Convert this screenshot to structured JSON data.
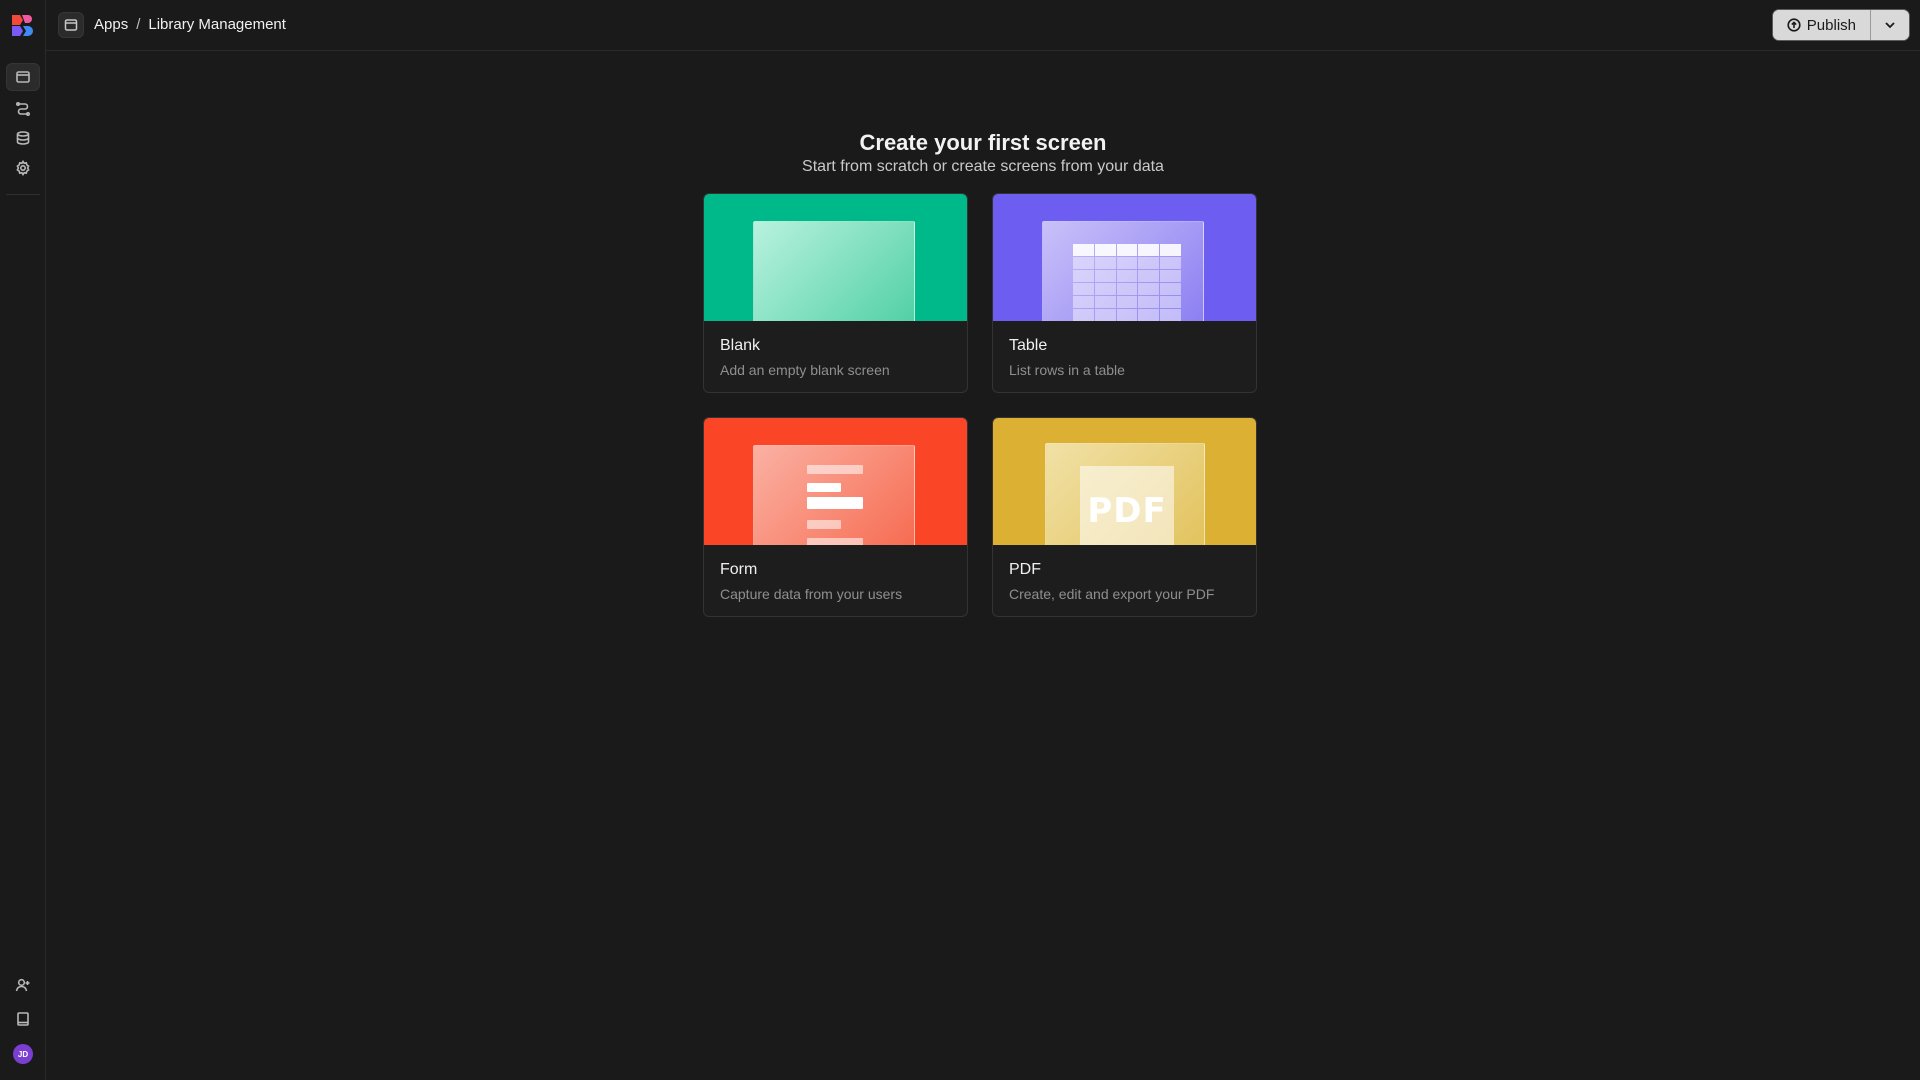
{
  "header": {
    "breadcrumb": [
      "Apps",
      "Library Management"
    ],
    "separator": "/",
    "publish_label": "Publish"
  },
  "sidebar": {
    "items": [
      {
        "icon": "screens-icon",
        "active": true
      },
      {
        "icon": "automation-icon",
        "active": false
      },
      {
        "icon": "database-icon",
        "active": false
      },
      {
        "icon": "settings-icon",
        "active": false
      }
    ],
    "bottom": [
      {
        "icon": "invite-user-icon"
      },
      {
        "icon": "book-icon"
      }
    ],
    "avatar_initials": "JD"
  },
  "main": {
    "title": "Create your first screen",
    "subtitle": "Start from scratch or create screens from your data",
    "cards": [
      {
        "key": "blank",
        "title": "Blank",
        "desc": "Add an empty blank screen",
        "color": "#00b98a"
      },
      {
        "key": "table",
        "title": "Table",
        "desc": "List rows in a table",
        "color": "#6d5df0"
      },
      {
        "key": "form",
        "title": "Form",
        "desc": "Capture data from your users",
        "color": "#fa4527"
      },
      {
        "key": "pdf",
        "title": "PDF",
        "desc": "Create, edit and export your PDF",
        "color": "#dbb033",
        "preview_text": "PDF"
      }
    ]
  }
}
